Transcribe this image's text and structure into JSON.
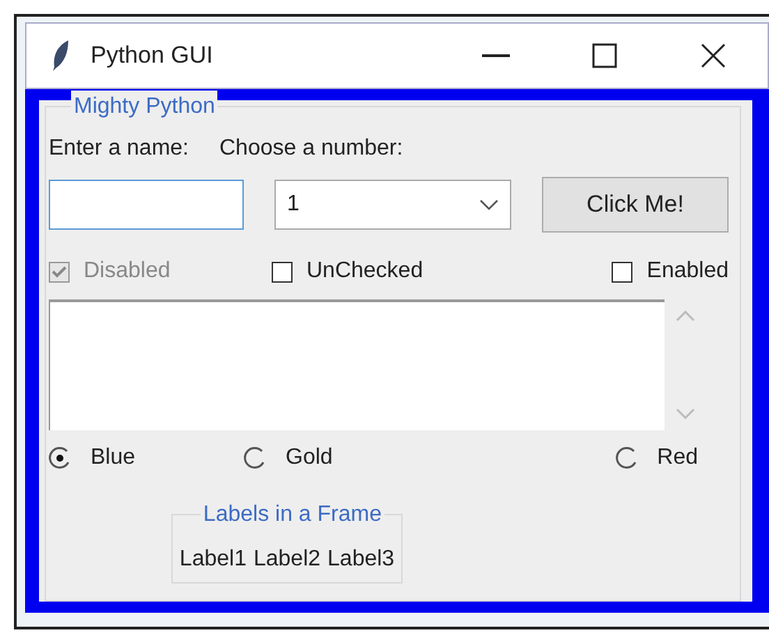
{
  "window": {
    "title": "Python GUI"
  },
  "frame": {
    "title": "Mighty Python",
    "name_field": {
      "label": "Enter a name:",
      "focused": true
    },
    "number_combo": {
      "label": "Choose a number:",
      "value": "1"
    },
    "button": {
      "label": "Click Me!"
    },
    "checkboxes": [
      {
        "label": "Disabled",
        "checked": true,
        "disabled": true
      },
      {
        "label": "UnChecked",
        "checked": false,
        "disabled": false
      },
      {
        "label": "Enabled",
        "checked": false,
        "disabled": false
      }
    ],
    "radios": [
      {
        "label": "Blue",
        "selected": true
      },
      {
        "label": "Gold",
        "selected": false
      },
      {
        "label": "Red",
        "selected": false
      }
    ],
    "labels_frame": {
      "title": "Labels in a Frame",
      "labels": [
        "Label1",
        "Label2",
        "Label3"
      ]
    }
  }
}
